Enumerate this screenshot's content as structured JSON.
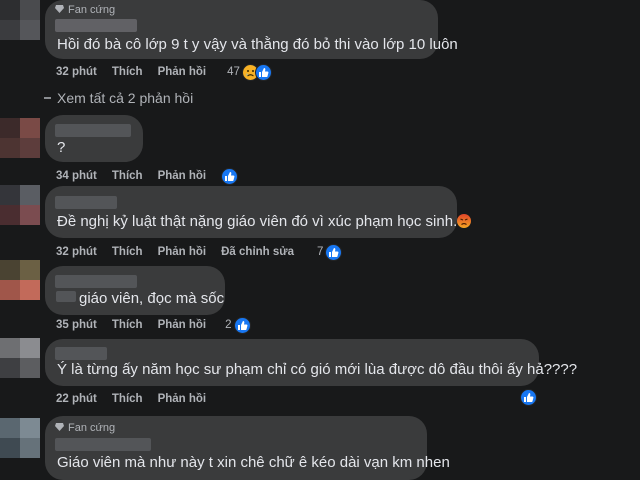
{
  "comments": [
    {
      "badge": "Fan cứng",
      "text": "Hồi đó bà cô lớp 9 t y vậy và thằng đó bỏ thi vào lớp 10 luôn",
      "time": "32 phút",
      "like": "Thích",
      "reply": "Phản hồi",
      "reaction_count": "47"
    },
    {
      "text": "?",
      "time": "34 phút",
      "like": "Thích",
      "reply": "Phản hồi"
    },
    {
      "text": "Đề nghị kỷ luật thật nặng giáo viên đó vì xúc phạm học sinh.",
      "time": "32 phút",
      "like": "Thích",
      "reply": "Phản hồi",
      "edited": "Đã chỉnh sửa",
      "reaction_count": "7"
    },
    {
      "text": "giáo viên, đọc mà sốc",
      "time": "35 phút",
      "like": "Thích",
      "reply": "Phản hồi",
      "reaction_count": "2"
    },
    {
      "text": "Ý là từng ấy năm học sư phạm chỉ có gió mới lùa được dô đầu thôi ấy hả????",
      "time": "22 phút",
      "like": "Thích",
      "reply": "Phản hồi"
    },
    {
      "badge": "Fan cứng",
      "text": "Giáo viên mà như này t xin chê chữ ê kéo dài vạn km nhen"
    }
  ],
  "view_replies": "Xem tất cả 2 phản hồi",
  "colors": {
    "background": "#18191a",
    "bubble": "#3a3b3c",
    "text": "#e4e6eb",
    "meta": "#b0b3b8",
    "like_blue": "#1877f2"
  },
  "icons": [
    "gem-icon",
    "like-reaction-icon",
    "sad-reaction-icon",
    "angry-emoji-icon"
  ]
}
